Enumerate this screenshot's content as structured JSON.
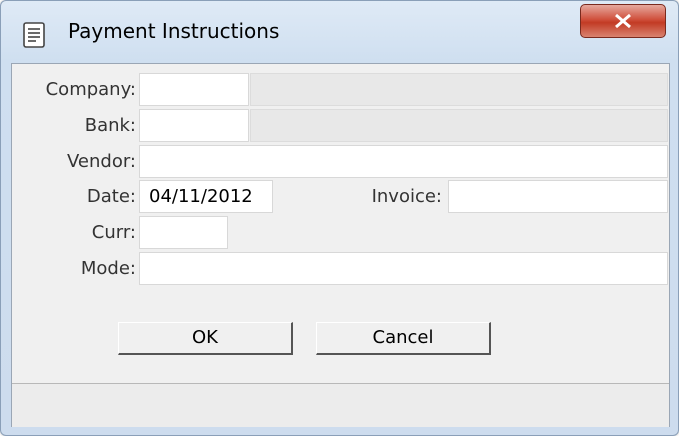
{
  "window": {
    "title": "Payment Instructions"
  },
  "form": {
    "company_label": "Company:",
    "company_value": "",
    "bank_label": "Bank:",
    "bank_value": "",
    "vendor_label": "Vendor:",
    "vendor_value": "",
    "date_label": "Date:",
    "date_value": "04/11/2012",
    "invoice_label": "Invoice:",
    "invoice_value": "",
    "curr_label": "Curr:",
    "curr_value": "",
    "mode_label": "Mode:",
    "mode_value": ""
  },
  "buttons": {
    "ok_label": "OK",
    "cancel_label": "Cancel"
  },
  "icons": {
    "app": "document-list-icon",
    "close": "close-icon"
  },
  "colors": {
    "close_button": "#c9442e",
    "titlebar": "#dfeaf6",
    "panel": "#f0f0f0"
  }
}
